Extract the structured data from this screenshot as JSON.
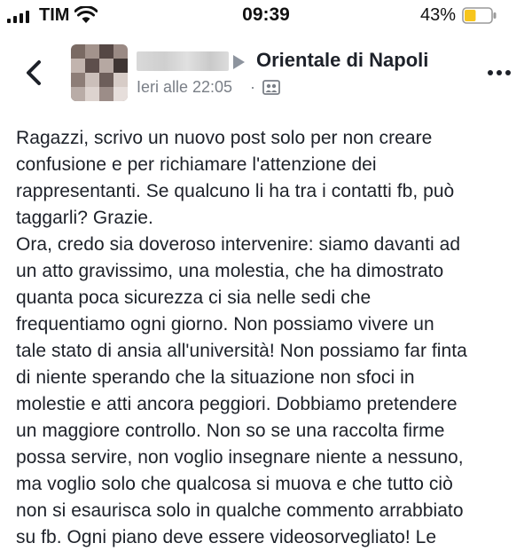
{
  "status_bar": {
    "carrier": "TIM",
    "time": "09:39",
    "battery_percent": "43%",
    "battery_level": 0.43,
    "battery_color": "#f7c51c",
    "icons": [
      "signal-icon",
      "wifi-icon",
      "battery-icon"
    ]
  },
  "post_header": {
    "back_icon": "chevron-left-icon",
    "group_name": "Orientale di Napoli",
    "timestamp": "Ieri alle 22:05",
    "separator": "·",
    "audience_icon": "group-audience-icon",
    "more_icon": "more-dots-icon"
  },
  "post": {
    "text": "Ragazzi, scrivo un nuovo post solo per non creare\nconfusione e per richiamare l'attenzione dei\nrappresentanti. Se qualcuno li ha tra i contatti fb, può\ntaggarli? Grazie.\nOra, credo sia doveroso intervenire: siamo davanti ad\nun atto gravissimo, una molestia, che ha dimostrato\nquanta poca sicurezza ci sia nelle sedi che\nfrequentiamo ogni giorno. Non possiamo vivere un\ntale stato di ansia all'università! Non possiamo far finta\ndi niente sperando che la situazione non sfoci in\nmolestie e atti ancora peggiori. Dobbiamo pretendere\nun maggiore controllo. Non so se una raccolta firme\npossa servire, non voglio insegnare niente a nessuno,\nma voglio solo che qualcosa si muova e che tutto ciò\nnon si esaurisca solo in qualche commento arrabbiato\nsu fb. Ogni piano deve essere videosorvegliato! Le"
  }
}
